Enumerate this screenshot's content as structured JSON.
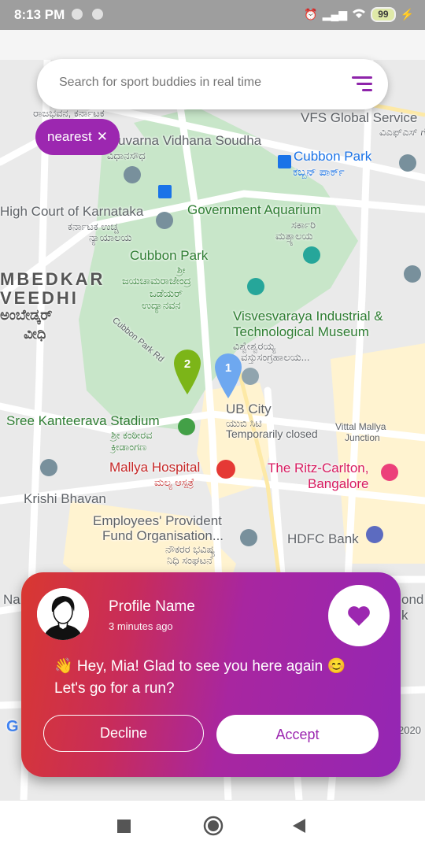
{
  "status_bar": {
    "time": "8:13 PM",
    "battery": "99"
  },
  "search": {
    "placeholder": "Search for sport buddies in real time"
  },
  "chip": {
    "label": "nearest",
    "close_glyph": "✕"
  },
  "map": {
    "labels": {
      "vfs": "VFS Global Service",
      "vfs_kn": "ವಿಎಫ್‌ಎಸ್ ಗ್ಲೋಬಲ್",
      "rajbhavan_kn": "ರಾಜಭವನ, ಕರ್ನಾಟಕ",
      "vidhana": "uvarna Vidhana Soudha",
      "vidhana_kn": "ವಿಧಾನಸೌಧ",
      "cubbon_park_metro": "Cubbon Park",
      "cubbon_park_metro_kn": "ಕಬ್ಬನ್ ಪಾರ್ಕ್",
      "high_court": "High Court of Karnataka",
      "high_court_kn": "ಕರ್ನಾಟಕ ಉಚ್ಚ",
      "high_court_kn2": "ನ್ಯಾಯಾಲಯ",
      "aquarium": "Government Aquarium",
      "aquarium_kn": "ಸರ್ಕಾರಿ",
      "aquarium_kn2": "ಮತ್ಸ್ಯಾಲಯ",
      "cubbon_park": "Cubbon Park",
      "cubbon_park_kn": "ಶ್ರೀ",
      "cubbon_park_kn2": "ಜಯಚಾಮರಾಜೇಂದ್ರ",
      "cubbon_park_kn3": "ಒಡೆಯರ್",
      "cubbon_park_kn4": "ಉದ್ಯಾನವನ",
      "ambedkar1": "MBEDKAR",
      "ambedkar2": "VEEDHI",
      "ambedkar_kn": "ಅಂಬೇಡ್ಕರ್",
      "ambedkar_kn2": "ವೀಧಿ",
      "museum": "Visvesvaraya Industrial &",
      "museum2": "Technological Museum",
      "museum_kn": "ವಿಶ್ವೇಶ್ವರಯ್ಯ",
      "museum_kn2": "ವಸ್ತುಸಂಗ್ರಹಾಲಯ...",
      "cubbon_rd": "Cubbon Park Rd",
      "ub_city": "UB City",
      "ub_city_kn": "ಯುಬಿ ಸಿಟಿ",
      "ub_city_status": "Temporarily closed",
      "vittal": "Vittal Mallya",
      "vittal2": "Junction",
      "stadium": "Sree Kanteerava Stadium",
      "stadium_kn": "ಶ್ರೀ ಕಂಠೀರವ",
      "stadium_kn2": "ಕ್ರೀಡಾಂಗಣ",
      "mallya": "Mallya Hospital",
      "mallya_kn": "ಮಲ್ಯ ಆಸ್ಪತ್ರೆ",
      "ritz": "The Ritz-Carlton,",
      "ritz2": "Bangalore",
      "krishi": "Krishi Bhavan",
      "epfo": "Employees' Provident",
      "epfo2": "Fund Organisation...",
      "epfo_kn": "ನೌಕರರ ಭವಿಷ್ಯ",
      "epfo_kn2": "ನಿಧಿ ಸಂಘಟನೆ",
      "hdfc": "HDFC Bank",
      "na": "Na",
      "ond": "ond",
      "k": "k",
      "google": "G",
      "year": "2020"
    },
    "markers": [
      {
        "label": "2",
        "color": "#7cb518"
      },
      {
        "label": "1",
        "color": "#6ea8f0"
      }
    ]
  },
  "card": {
    "profile_name": "Profile Name",
    "time_ago": "3 minutes ago",
    "message_line1": "👋 Hey, Mia! Glad to see you here again 😊",
    "message_line2": "Let's go for a run?",
    "decline_label": "Decline",
    "accept_label": "Accept"
  },
  "colors": {
    "accent": "#9c27b0",
    "gradient_start": "#d93830",
    "gradient_end": "#9426b4"
  },
  "icons": [
    "filter-icon",
    "close-icon",
    "heart-icon",
    "avatar-icon",
    "square-nav-icon",
    "circle-nav-icon",
    "back-nav-icon"
  ]
}
